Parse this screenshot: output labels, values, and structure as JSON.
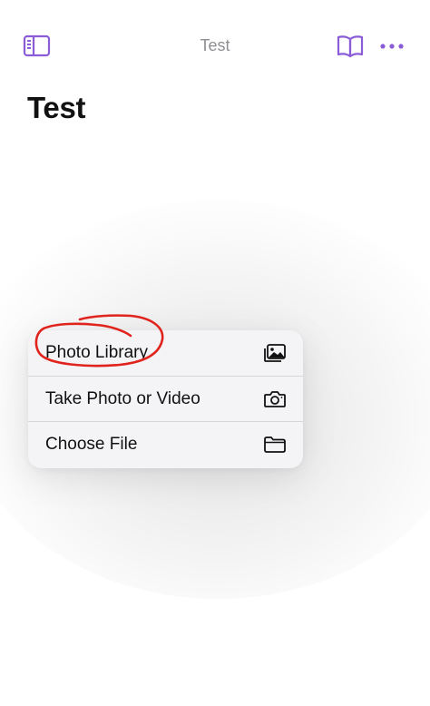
{
  "nav": {
    "title": "Test",
    "sidebar_icon": "sidebar-icon",
    "book_icon": "book-icon",
    "more_icon": "ellipsis-icon"
  },
  "page": {
    "title": "Test"
  },
  "menu": {
    "items": [
      {
        "label": "Photo Library",
        "icon": "photo-library-icon"
      },
      {
        "label": "Take Photo or Video",
        "icon": "camera-icon"
      },
      {
        "label": "Choose File",
        "icon": "folder-icon"
      }
    ]
  },
  "colors": {
    "accent": "#8a5cd8",
    "annotation": "#e0241d",
    "title_gray": "#8e8e93",
    "menu_bg": "#f4f4f6"
  }
}
